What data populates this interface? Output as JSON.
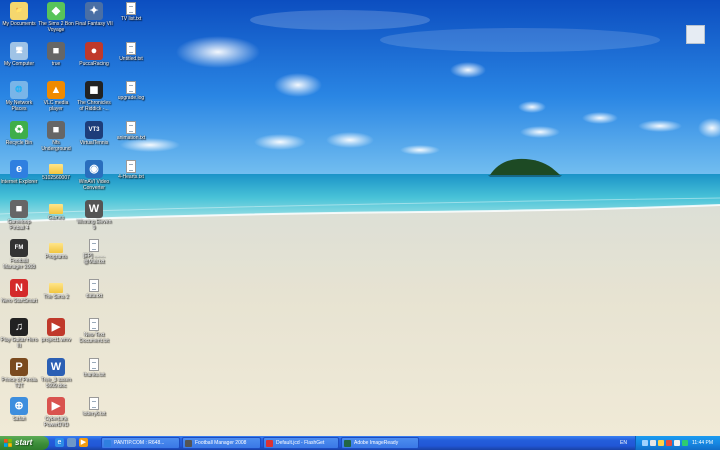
{
  "desktop_icons": [
    {
      "id": "my-documents",
      "label": "My Documents",
      "icon": "my-documents-icon",
      "col": 0,
      "row": 0
    },
    {
      "id": "sims2-bon-voyage",
      "label": "The Sims 2 Bon Voyage",
      "icon": "sims-icon",
      "col": 1,
      "row": 0
    },
    {
      "id": "ff7",
      "label": "Final Fantasy VII",
      "icon": "ff7-icon",
      "col": 2,
      "row": 0
    },
    {
      "id": "tv-list",
      "label": "TV list.txt",
      "icon": "text-file-icon",
      "col": 3,
      "row": 0
    },
    {
      "id": "my-computer",
      "label": "My Computer",
      "icon": "my-computer-icon",
      "col": 0,
      "row": 1
    },
    {
      "id": "true",
      "label": "true",
      "icon": "app-icon",
      "col": 1,
      "row": 1
    },
    {
      "id": "pucca-racing",
      "label": "PuccaRacing",
      "icon": "pucca-icon",
      "col": 2,
      "row": 1
    },
    {
      "id": "untitled",
      "label": "Untitled.txt",
      "icon": "text-file-icon",
      "col": 3,
      "row": 1
    },
    {
      "id": "network-places",
      "label": "My Network Places",
      "icon": "network-places-icon",
      "col": 0,
      "row": 2
    },
    {
      "id": "vlc",
      "label": "VLC media player",
      "icon": "vlc-icon",
      "col": 1,
      "row": 2
    },
    {
      "id": "chronicles-riddick",
      "label": "The Chronicles of Riddick -...",
      "icon": "riddick-icon",
      "col": 2,
      "row": 2
    },
    {
      "id": "upgrade-log",
      "label": "upgrade.log",
      "icon": "text-file-icon",
      "col": 3,
      "row": 2
    },
    {
      "id": "recycle-bin",
      "label": "Recycle Bin",
      "icon": "recycle-bin-icon",
      "col": 0,
      "row": 3
    },
    {
      "id": "nfs",
      "label": "Nfs Underground",
      "icon": "app-icon",
      "col": 1,
      "row": 3
    },
    {
      "id": "vt3",
      "label": "VirtualTennis",
      "icon": "vt3-icon",
      "col": 2,
      "row": 3
    },
    {
      "id": "text-file-4",
      "label": "animation.txt",
      "icon": "text-file-icon",
      "col": 3,
      "row": 3
    },
    {
      "id": "internet-explorer",
      "label": "Internet Explorer",
      "icon": "ie-icon",
      "col": 0,
      "row": 4
    },
    {
      "id": "folder-5102",
      "label": "5102560007",
      "icon": "folder-icon",
      "col": 1,
      "row": 4
    },
    {
      "id": "video-converter",
      "label": "WinAVI Video Converter",
      "icon": "converter-icon",
      "col": 2,
      "row": 4
    },
    {
      "id": "text-file-5",
      "label": "4-Hearts.txt",
      "icon": "text-file-icon",
      "col": 3,
      "row": 4
    },
    {
      "id": "gameloop",
      "label": "Gameloop Pinball 4",
      "icon": "app-icon",
      "col": 0,
      "row": 5
    },
    {
      "id": "games",
      "label": "Games",
      "icon": "folder-icon",
      "col": 1,
      "row": 5
    },
    {
      "id": "winning-eleven",
      "label": "Winning Eleven 9",
      "icon": "we9-icon",
      "col": 2,
      "row": 5
    },
    {
      "id": "football-manager",
      "label": "Football Manager 2008",
      "icon": "fm-icon",
      "col": 0,
      "row": 6
    },
    {
      "id": "programs",
      "label": "Programs",
      "icon": "folder-icon",
      "col": 1,
      "row": 6
    },
    {
      "id": "ep-file",
      "label": "[EP] ........ @Mail.txt",
      "icon": "text-file-icon",
      "col": 2,
      "row": 6
    },
    {
      "id": "nero",
      "label": "Nero StartSmart",
      "icon": "nero-icon",
      "col": 0,
      "row": 7
    },
    {
      "id": "sims2",
      "label": "The Sims 2",
      "icon": "folder-icon",
      "col": 1,
      "row": 7
    },
    {
      "id": "data-txt",
      "label": "data.txt",
      "icon": "text-file-icon",
      "col": 2,
      "row": 7
    },
    {
      "id": "guitar-hero",
      "label": "Play Guitar Hero III",
      "icon": "guitar-icon",
      "col": 0,
      "row": 8
    },
    {
      "id": "project1-wmv",
      "label": "project1.wmv",
      "icon": "wmv-icon",
      "col": 1,
      "row": 8
    },
    {
      "id": "new-text",
      "label": "New Text Document.txt",
      "icon": "text-file-icon",
      "col": 2,
      "row": 8
    },
    {
      "id": "prince-persia",
      "label": "Prince of Persia T2T",
      "icon": "persia-icon",
      "col": 0,
      "row": 9
    },
    {
      "id": "doc-file",
      "label": "Tree_3 assen 5609.doc",
      "icon": "word-doc-icon",
      "col": 1,
      "row": 9
    },
    {
      "id": "thanks-txt",
      "label": "thanks.txt",
      "icon": "text-file-icon",
      "col": 2,
      "row": 9
    },
    {
      "id": "safari",
      "label": "Safari",
      "icon": "safari-icon",
      "col": 0,
      "row": 10
    },
    {
      "id": "cyberlink",
      "label": "CyberLink PowerDVD",
      "icon": "powerdvd-icon",
      "col": 1,
      "row": 10
    },
    {
      "id": "lottery",
      "label": "lottery6.txt",
      "icon": "text-file-icon",
      "col": 2,
      "row": 10
    }
  ],
  "taskbar": {
    "start_label": "start",
    "quick_launch": [
      "ie-icon",
      "show-desktop-icon",
      "media-player-icon"
    ],
    "tasks": [
      {
        "label": "PANTIP.COM : R648...",
        "icon": "ie-icon",
        "color": "#2f7fe0"
      },
      {
        "label": "Football Manager 2008",
        "icon": "fm-icon",
        "color": "#555"
      },
      {
        "label": "Default.jcd - FlashGet",
        "icon": "flashget-icon",
        "color": "#d33"
      },
      {
        "label": "Adobe ImageReady",
        "icon": "imageready-icon",
        "color": "#264"
      }
    ],
    "language": "EN",
    "clock": "11:44 PM"
  },
  "colors": {
    "taskbar": "#245edb",
    "start": "#3c8e3a",
    "tray": "#1683df"
  }
}
